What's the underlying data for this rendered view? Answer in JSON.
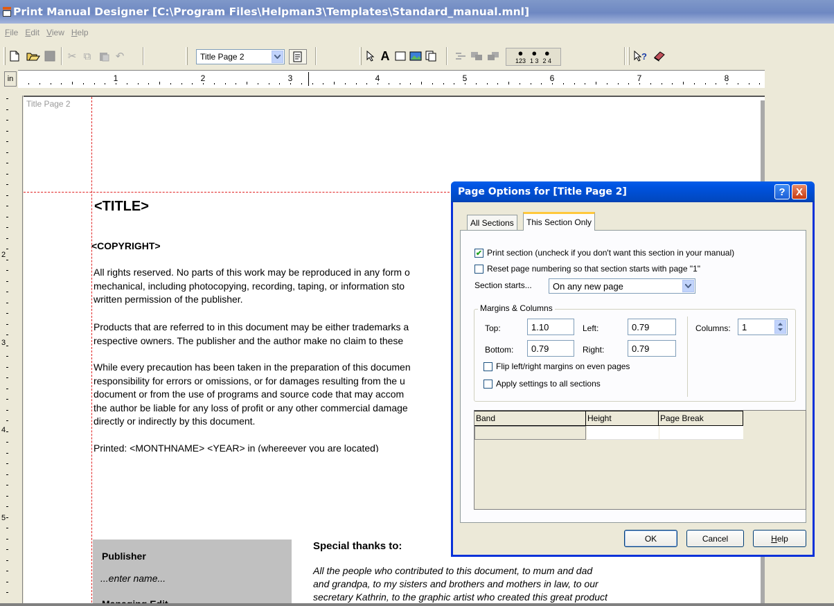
{
  "window": {
    "title": "Print Manual Designer [C:\\Program Files\\Helpman3\\Templates\\Standard_manual.mnl]"
  },
  "menu": [
    {
      "label": "File",
      "accel": "F",
      "rest": "ile"
    },
    {
      "label": "Edit",
      "accel": "E",
      "rest": "dit"
    },
    {
      "label": "View",
      "accel": "V",
      "rest": "iew"
    },
    {
      "label": "Help",
      "accel": "H",
      "rest": "elp"
    }
  ],
  "toolbar": {
    "section_combo_value": "Title Page 2",
    "icons": [
      "new-icon",
      "open-icon",
      "save-icon",
      "cut-icon",
      "copy-icon",
      "paste-icon",
      "undo-icon",
      "page-options-icon",
      "select-arrow-icon",
      "text-tool-icon",
      "rectangle-tool-icon",
      "image-tool-icon",
      "copy-band-icon",
      "align-icon",
      "bring-front-icon",
      "send-back-icon",
      "preview-123-icon",
      "preview-odd-icon",
      "preview-even-icon",
      "context-help-icon",
      "book-icon"
    ],
    "preview_labels": [
      "123",
      "1 3",
      "2 4"
    ]
  },
  "ruler": {
    "unit": "in",
    "numbers": [
      "1",
      "2",
      "3",
      "4",
      "5",
      "6",
      "7",
      "8"
    ],
    "vertical_numbers": [
      "2",
      "3",
      "4",
      "5"
    ]
  },
  "document": {
    "section_label": "Title Page 2",
    "title": "<TITLE>",
    "copyright": "<COPYRIGHT>",
    "paragraph1": "All rights reserved. No parts of this work may be reproduced in any form o\nmechanical, including photocopying, recording, taping, or information sto\nwritten permission of the publisher.",
    "paragraph2": "Products that are referred to in this document may be either trademarks a\nrespective owners. The publisher and the author make no claim to these",
    "paragraph3": "While every precaution has been taken in the preparation of this documen\nresponsibility for errors or omissions, or for damages resulting from the u\ndocument or from the use of programs and source code that may accom\nthe author be liable for any loss of profit or any other commercial damage\ndirectly or indirectly by this document.",
    "printed": "Printed: <MONTHNAME> <YEAR> in (whereever you are located)",
    "publisher_label": "Publisher",
    "publisher_name": "...enter name...",
    "managing_editor_label": "Managing Edit",
    "thanks_title": "Special thanks to:",
    "thanks_text": "All the people who contributed to this document, to mum and dad\nand grandpa, to my sisters and brothers and mothers in law, to our\nsecretary Kathrin, to the graphic artist who created this great product"
  },
  "dialog": {
    "title": "Page Options for [Title Page 2]",
    "help_button": "?",
    "close_button": "X",
    "tabs": [
      "All Sections",
      "This Section Only"
    ],
    "active_tab": "This Section Only",
    "print_section_label": "Print section (uncheck if you don't want this section in your manual)",
    "print_section_checked": true,
    "reset_numbering_label": "Reset page numbering so that section starts with page \"1\"",
    "reset_numbering_checked": false,
    "section_starts_label": "Section starts...",
    "section_starts_value": "On any new page",
    "margins_group_label": "Margins & Columns",
    "top_label": "Top:",
    "top_value": "1.10",
    "left_label": "Left:",
    "left_value": "0.79",
    "bottom_label": "Bottom:",
    "bottom_value": "0.79",
    "right_label": "Right:",
    "right_value": "0.79",
    "columns_label": "Columns:",
    "columns_value": "1",
    "flip_margins_label": "Flip left/right margins on even pages",
    "flip_margins_checked": false,
    "apply_all_label": "Apply settings to all sections",
    "apply_all_checked": false,
    "grid_headers": [
      "Band",
      "Height",
      "Page Break"
    ],
    "ok_label": "OK",
    "cancel_label": "Cancel",
    "help_label": "Help"
  },
  "colors": {
    "title_bar": "#7f98c9",
    "dialog_title": "#0054e3",
    "guide_line": "#e02020",
    "publisher_box": "#c0c0c0"
  }
}
